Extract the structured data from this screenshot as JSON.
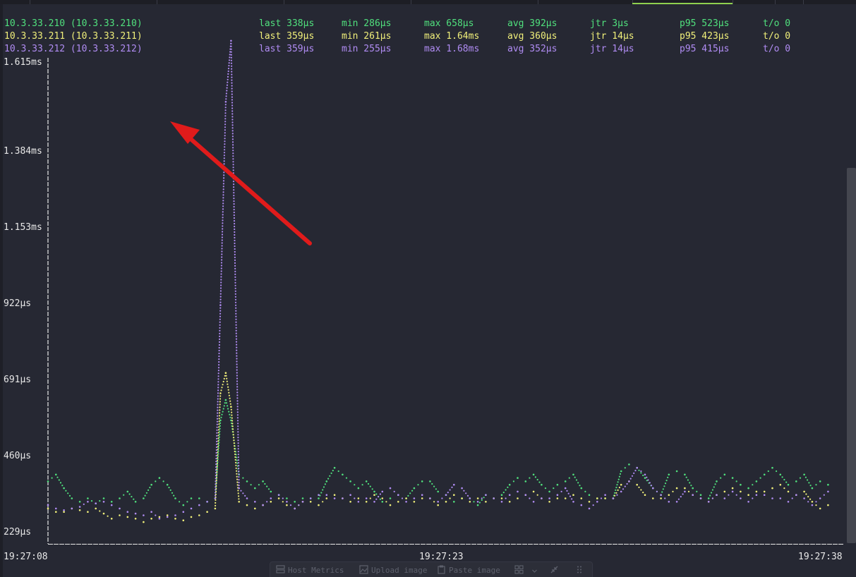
{
  "colors": {
    "background": "#262833",
    "host1": "#50e07d",
    "host2": "#f0ef7a",
    "host3": "#b08cf3",
    "axis": "#e8e8e8",
    "annotation_arrow": "#e01b1b"
  },
  "hosts": [
    {
      "name": "10.3.33.210 (10.3.33.210)",
      "last": "last 338µs",
      "min": "min 286µs",
      "max": "max 658µs",
      "avg": "avg 392µs",
      "jtr": "jtr 3µs",
      "p95": "p95 523µs",
      "to": "t/o 0"
    },
    {
      "name": "10.3.33.211 (10.3.33.211)",
      "last": "last 359µs",
      "min": "min 261µs",
      "max": "max 1.64ms",
      "avg": "avg 360µs",
      "jtr": "jtr 14µs",
      "p95": "p95 423µs",
      "to": "t/o 0"
    },
    {
      "name": "10.3.33.212 (10.3.33.212)",
      "last": "last 359µs",
      "min": "min 255µs",
      "max": "max 1.68ms",
      "avg": "avg 352µs",
      "jtr": "jtr 14µs",
      "p95": "p95 415µs",
      "to": "t/o 0"
    }
  ],
  "chart_data": {
    "type": "scatter",
    "y_ticks": [
      "1.615ms",
      "1.384ms",
      "1.153ms",
      "922µs",
      "691µs",
      "460µs",
      "229µs"
    ],
    "x_ticks": [
      "19:27:08",
      "19:27:23",
      "19:27:38"
    ],
    "ylim_us": [
      229,
      1615
    ],
    "x_range_s": [
      0,
      30
    ],
    "series": [
      {
        "name": "10.3.33.210 (10.3.33.210)",
        "color": "#50e07d",
        "t": [
          0,
          0.3,
          0.6,
          0.9,
          1.2,
          1.5,
          1.8,
          2.1,
          2.4,
          2.7,
          3.0,
          3.3,
          3.6,
          3.9,
          4.2,
          4.5,
          4.8,
          5.1,
          5.4,
          5.7,
          6.0,
          6.3,
          6.5,
          6.7,
          6.9,
          7.2,
          7.5,
          7.8,
          8.1,
          8.4,
          8.7,
          9.0,
          9.3,
          9.6,
          9.9,
          10.2,
          10.5,
          10.8,
          11.1,
          11.4,
          11.7,
          12.0,
          12.3,
          12.6,
          12.9,
          13.2,
          13.5,
          13.8,
          14.1,
          14.4,
          14.7,
          15.0,
          15.3,
          15.6,
          15.9,
          16.2,
          16.5,
          16.8,
          17.1,
          17.4,
          17.7,
          18.0,
          18.3,
          18.6,
          18.9,
          19.2,
          19.5,
          19.8,
          20.1,
          20.4,
          20.7,
          21.0,
          21.3,
          21.6,
          21.9,
          22.2,
          22.5,
          22.8,
          23.1,
          23.4,
          23.7,
          24.0,
          24.3,
          24.6,
          24.9,
          25.2,
          25.5,
          25.8,
          26.1,
          26.4,
          26.7,
          27.0,
          27.3,
          27.6,
          27.9,
          28.2,
          28.5,
          28.8,
          29.1,
          29.4
        ],
        "v": [
          380,
          400,
          360,
          330,
          320,
          330,
          315,
          330,
          320,
          330,
          350,
          320,
          330,
          370,
          390,
          370,
          330,
          310,
          330,
          330,
          320,
          330,
          560,
          620,
          560,
          400,
          380,
          360,
          380,
          350,
          340,
          330,
          320,
          330,
          330,
          330,
          380,
          420,
          400,
          380,
          360,
          380,
          350,
          320,
          330,
          340,
          330,
          360,
          380,
          380,
          350,
          340,
          320,
          330,
          330,
          310,
          340,
          330,
          340,
          370,
          390,
          380,
          400,
          370,
          350,
          370,
          380,
          400,
          360,
          340,
          330,
          330,
          330,
          410,
          430,
          420,
          390,
          360,
          340,
          400,
          410,
          400,
          360,
          340,
          330,
          380,
          400,
          390,
          370,
          360,
          380,
          400,
          420,
          400,
          370,
          380,
          400,
          360,
          380,
          370
        ]
      },
      {
        "name": "10.3.33.211 (10.3.33.211)",
        "color": "#f0ef7a",
        "t": [
          0,
          0.3,
          0.6,
          0.9,
          1.2,
          1.5,
          1.8,
          2.1,
          2.4,
          2.7,
          3.0,
          3.3,
          3.6,
          3.9,
          4.2,
          4.5,
          4.8,
          5.1,
          5.4,
          5.7,
          6.0,
          6.3,
          6.5,
          6.7,
          6.9,
          7.2,
          7.5,
          7.8,
          8.1,
          8.4,
          8.7,
          9.0,
          9.3,
          9.6,
          9.9,
          10.2,
          10.5,
          10.8,
          11.1,
          11.4,
          11.7,
          12.0,
          12.3,
          12.6,
          12.9,
          13.2,
          13.5,
          13.8,
          14.1,
          14.4,
          14.7,
          15.0,
          15.3,
          15.6,
          15.9,
          16.2,
          16.5,
          16.8,
          17.1,
          17.4,
          17.7,
          18.0,
          18.3,
          18.6,
          18.9,
          19.2,
          19.5,
          19.8,
          20.1,
          20.4,
          20.7,
          21.0,
          21.3,
          21.6,
          21.9,
          22.2,
          22.5,
          22.8,
          23.1,
          23.4,
          23.7,
          24.0,
          24.3,
          24.6,
          24.9,
          25.2,
          25.5,
          25.8,
          26.1,
          26.4,
          26.7,
          27.0,
          27.3,
          27.6,
          27.9,
          28.2,
          28.5,
          28.8,
          29.1,
          29.4
        ],
        "v": [
          300,
          290,
          290,
          300,
          295,
          290,
          300,
          285,
          270,
          280,
          275,
          270,
          260,
          270,
          275,
          280,
          270,
          265,
          275,
          280,
          290,
          300,
          640,
          700,
          600,
          320,
          310,
          300,
          310,
          320,
          330,
          310,
          300,
          320,
          320,
          310,
          330,
          340,
          330,
          320,
          330,
          320,
          340,
          330,
          310,
          320,
          330,
          320,
          330,
          330,
          310,
          320,
          340,
          330,
          320,
          330,
          320,
          330,
          330,
          320,
          330,
          340,
          350,
          330,
          320,
          330,
          330,
          340,
          330,
          320,
          330,
          330,
          330,
          370,
          380,
          370,
          340,
          330,
          330,
          340,
          360,
          360,
          340,
          330,
          320,
          340,
          350,
          360,
          350,
          340,
          350,
          350,
          360,
          370,
          350,
          340,
          350,
          320,
          300,
          310
        ]
      },
      {
        "name": "10.3.33.212 (10.3.33.212)",
        "color": "#b08cf3",
        "t": [
          0,
          0.3,
          0.6,
          0.9,
          1.2,
          1.5,
          1.8,
          2.1,
          2.4,
          2.7,
          3.0,
          3.3,
          3.6,
          3.9,
          4.2,
          4.5,
          4.8,
          5.1,
          5.4,
          5.7,
          6.0,
          6.3,
          6.5,
          6.7,
          6.9,
          7.2,
          7.5,
          7.8,
          8.1,
          8.4,
          8.7,
          9.0,
          9.3,
          9.6,
          9.9,
          10.2,
          10.5,
          10.8,
          11.1,
          11.4,
          11.7,
          12.0,
          12.3,
          12.6,
          12.9,
          13.2,
          13.5,
          13.8,
          14.1,
          14.4,
          14.7,
          15.0,
          15.3,
          15.6,
          15.9,
          16.2,
          16.5,
          16.8,
          17.1,
          17.4,
          17.7,
          18.0,
          18.3,
          18.6,
          18.9,
          19.2,
          19.5,
          19.8,
          20.1,
          20.4,
          20.7,
          21.0,
          21.3,
          21.6,
          21.9,
          22.2,
          22.5,
          22.8,
          23.1,
          23.4,
          23.7,
          24.0,
          24.3,
          24.6,
          24.9,
          25.2,
          25.5,
          25.8,
          26.1,
          26.4,
          26.7,
          27.0,
          27.3,
          27.6,
          27.9,
          28.2,
          28.5,
          28.8,
          29.1,
          29.4
        ],
        "v": [
          310,
          300,
          295,
          300,
          305,
          320,
          315,
          320,
          310,
          300,
          290,
          285,
          280,
          290,
          270,
          275,
          280,
          290,
          300,
          310,
          320,
          330,
          900,
          1500,
          1680,
          360,
          330,
          320,
          310,
          330,
          340,
          320,
          300,
          320,
          330,
          340,
          340,
          330,
          330,
          340,
          320,
          330,
          320,
          350,
          360,
          340,
          320,
          330,
          340,
          330,
          320,
          340,
          370,
          360,
          330,
          320,
          340,
          330,
          320,
          340,
          350,
          340,
          320,
          330,
          330,
          340,
          360,
          320,
          310,
          300,
          320,
          340,
          330,
          350,
          380,
          420,
          400,
          360,
          340,
          320,
          320,
          350,
          340,
          330,
          320,
          340,
          330,
          350,
          330,
          320,
          340,
          340,
          330,
          330,
          320,
          340,
          330,
          310,
          330,
          350
        ]
      }
    ]
  },
  "toolbar": {
    "host_metrics": "Host Metrics",
    "upload_image": "Upload image",
    "paste_image": "Paste image"
  }
}
